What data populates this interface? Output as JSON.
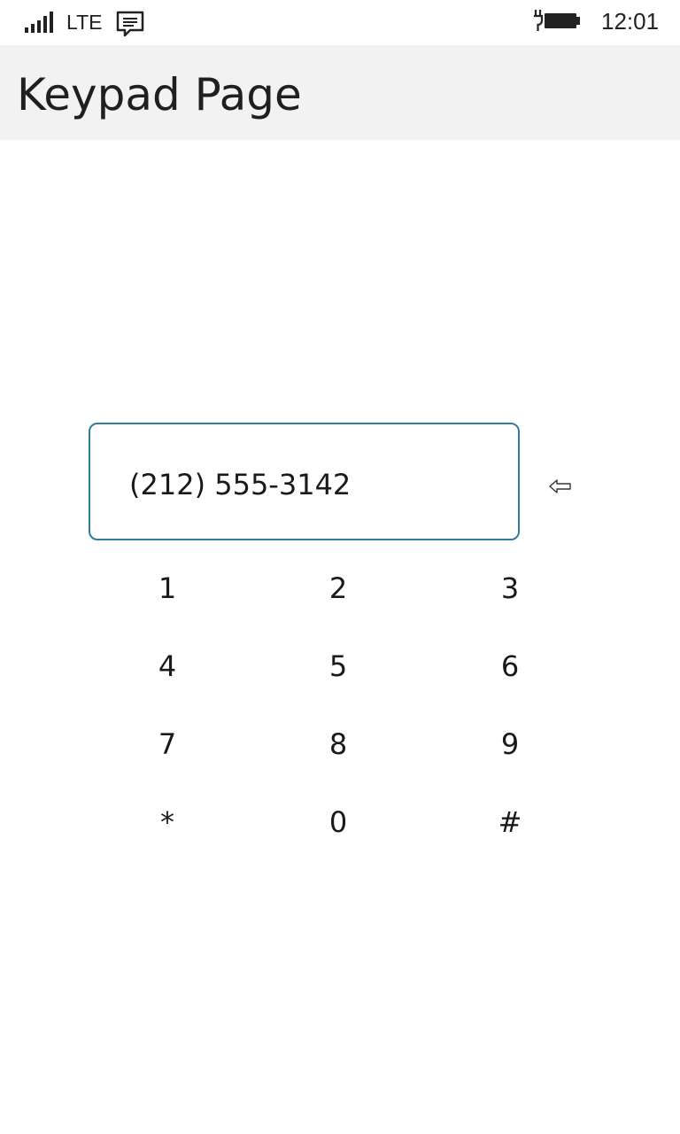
{
  "status_bar": {
    "network": "LTE",
    "time": "12:01",
    "icons": [
      "signal-strength-icon",
      "message-icon",
      "battery-charging-icon"
    ]
  },
  "header": {
    "title": "Keypad Page"
  },
  "display": {
    "value": "(212) 555-3142"
  },
  "backspace": {
    "label": "⇦",
    "icon": "backspace-arrow-icon"
  },
  "keypad": {
    "keys": [
      "1",
      "2",
      "3",
      "4",
      "5",
      "6",
      "7",
      "8",
      "9",
      "*",
      "0",
      "#"
    ]
  },
  "colors": {
    "accent": "#2e7d9b",
    "header_bg": "#f2f2f2",
    "background": "#ffffff",
    "text": "#1a1a1a"
  }
}
